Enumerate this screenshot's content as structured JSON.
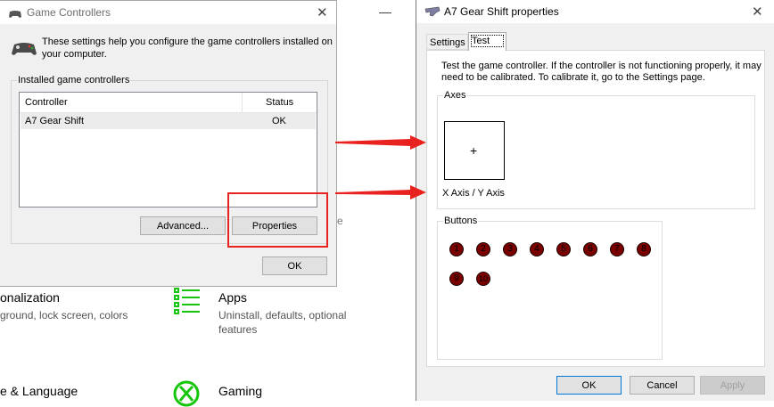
{
  "background_settings": {
    "close_icon_glyph": "—",
    "personalization": {
      "title": "onalization",
      "desc": "ground, lock screen, colors"
    },
    "apps": {
      "title": "Apps",
      "desc_line1": "Uninstall, defaults, optional",
      "desc_line2": "features",
      "icon": "apps-list-icon"
    },
    "time_language": {
      "title": "e & Language"
    },
    "gaming": {
      "title": "Gaming",
      "icon": "xbox-icon"
    },
    "stray_fragment": "e"
  },
  "game_controllers": {
    "title": "Game Controllers",
    "close_glyph": "✕",
    "intro": [
      "These settings help you configure the game controllers installed on",
      "your computer."
    ],
    "group_label": "Installed game controllers",
    "columns": {
      "controller": "Controller",
      "status": "Status"
    },
    "rows": [
      {
        "controller": "A7 Gear Shift",
        "status": "OK"
      }
    ],
    "buttons": {
      "advanced": "Advanced...",
      "properties": "Properties",
      "ok": "OK"
    }
  },
  "properties": {
    "title": "A7 Gear Shift properties",
    "close_glyph": "✕",
    "tabs": [
      {
        "label": "Settings",
        "active": false
      },
      {
        "label": "Test",
        "active": true
      }
    ],
    "description": [
      "Test the game controller.  If the controller is not functioning properly, it may",
      "need to be calibrated.  To calibrate it, go to the Settings page."
    ],
    "axes_label": "Axes",
    "crosshair_glyph": "+",
    "axis_caption": "X Axis / Y Axis",
    "buttons_label": "Buttons",
    "indicators": [
      "1",
      "2",
      "3",
      "4",
      "5",
      "6",
      "7",
      "8",
      "9",
      "10"
    ],
    "footer": {
      "ok": "OK",
      "cancel": "Cancel",
      "apply": "Apply"
    }
  },
  "colors": {
    "accent_blue": "#0078d7",
    "annotation_red": "#e8231f",
    "apps_green": "#16c60c",
    "indicator_dark_red": "#7a0000"
  }
}
